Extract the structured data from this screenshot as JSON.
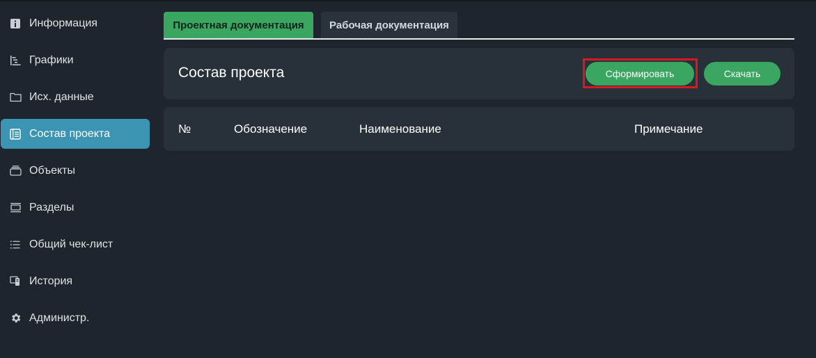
{
  "sidebar": {
    "items": [
      {
        "label": "Информация",
        "icon": "info-icon",
        "active": false
      },
      {
        "label": "Графики",
        "icon": "gantt-chart-icon",
        "active": false
      },
      {
        "label": "Исх. данные",
        "icon": "folder-icon",
        "active": false
      },
      {
        "label": "Состав проекта",
        "icon": "document-list-icon",
        "active": true
      },
      {
        "label": "Объекты",
        "icon": "stack-icon",
        "active": false
      },
      {
        "label": "Разделы",
        "icon": "sections-icon",
        "active": false
      },
      {
        "label": "Общий чек-лист",
        "icon": "checklist-icon",
        "active": false
      },
      {
        "label": "История",
        "icon": "history-icon",
        "active": false
      },
      {
        "label": "Администр.",
        "icon": "gear-icon",
        "active": false
      }
    ]
  },
  "tabs": [
    {
      "label": "Проектная документация",
      "active": true
    },
    {
      "label": "Рабочая документация",
      "active": false
    }
  ],
  "header": {
    "title": "Состав проекта",
    "generate_label": "Сформировать",
    "download_label": "Скачать"
  },
  "table": {
    "columns": [
      "№",
      "Обозначение",
      "Наименование",
      "Примечание"
    ]
  },
  "colors": {
    "background": "#1e252c",
    "panel": "#28313a",
    "accent_green": "#3aa661",
    "active_sidebar": "#3a94b2",
    "highlight_red": "#d8191f"
  }
}
